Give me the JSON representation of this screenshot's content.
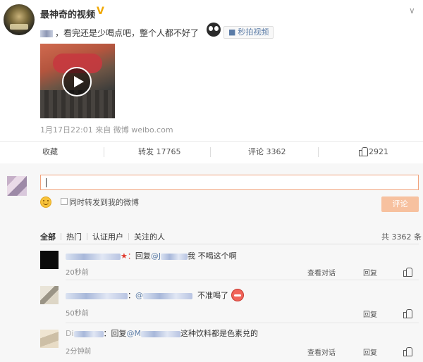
{
  "post": {
    "author_name": "最神奇的视频",
    "text_prefix": "，",
    "text_main": "看完还是少喝点吧，整个人都不好了",
    "video_tag": "秒拍视频",
    "meta_time": "1月17日22:01",
    "meta_source_prefix": "来自",
    "meta_source": "微博 weibo.com"
  },
  "actions": {
    "favorite": "收藏",
    "repost": "转发 17765",
    "comment": "评论 3362",
    "like": "2921"
  },
  "composer": {
    "repost_checkbox_label": "同时转发到我的微博",
    "submit_label": "评论"
  },
  "comments_header": {
    "filters": [
      "全部",
      "热门",
      "认证用户",
      "关注的人"
    ],
    "total": "共 3362 条"
  },
  "comments": [
    {
      "name_suffix": "★：",
      "reply_word": "回复",
      "at": "@J",
      "text": "我 不喝这个啊",
      "time": "20秒前",
      "view_conversation": "查看对话",
      "reply": "回复"
    },
    {
      "name_suffix": "：",
      "at": "@",
      "text": "不准喝了",
      "time": "50秒前",
      "reply": "回复"
    },
    {
      "name_prefix": "Di",
      "name_suffix": "：",
      "reply_word": "回复",
      "at": "@M",
      "text": "这种饮料都是色素兑的",
      "time": "2分钟前",
      "view_conversation": "查看对话",
      "reply": "回复"
    }
  ],
  "colors": {
    "link": "#5b7ca7",
    "input_border": "#f1a37c",
    "submit_bg": "#f7c19f",
    "vip": "#f0a800"
  },
  "icons": [
    "play-icon",
    "video-camera-icon",
    "chevron-down-icon",
    "thumbs-up-icon",
    "smiley-icon",
    "angry-face-icon",
    "eyes-emoji-icon",
    "verified-v-icon"
  ]
}
